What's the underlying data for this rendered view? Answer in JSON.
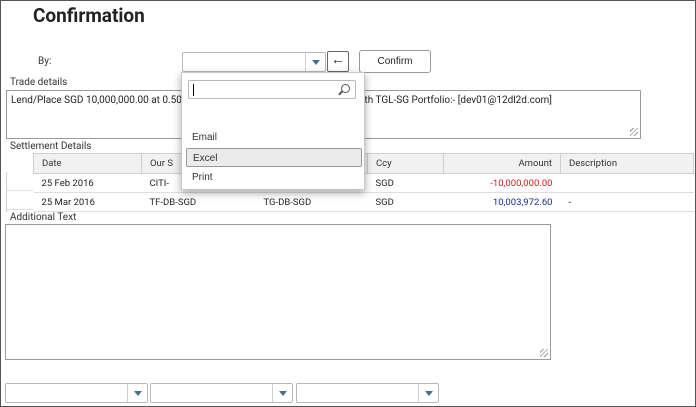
{
  "title": "Confirmation",
  "by": {
    "label": "By:",
    "value": ""
  },
  "confirm_label": "Confirm",
  "trade": {
    "label": "Trade details",
    "text_left": "Lend/Place SGD 10,000,000.00 at 0.500",
    "text_right": "ith TGL-SG  Portfolio:- [dev01@12dl2d.com]"
  },
  "settlement": {
    "label": "Settlement Details",
    "columns": [
      "Date",
      "Our S",
      "",
      "Ccy",
      "Amount",
      "Description"
    ],
    "rows": [
      {
        "date": "25 Feb 2016",
        "ours": "CITI-",
        "theirs": "",
        "ccy": "SGD",
        "amount": "-10,000,000.00",
        "desc": ""
      },
      {
        "date": "25 Mar 2016",
        "ours": "TF-DB-SGD",
        "theirs": "TG-DB-SGD",
        "ccy": "SGD",
        "amount": "10,003,972.60",
        "desc": "-"
      }
    ]
  },
  "additional": {
    "label": "Additional Text",
    "value": ""
  },
  "dropdown": {
    "search_value": "",
    "options": [
      "Email",
      "Excel",
      "Print"
    ],
    "selected": "Excel"
  }
}
